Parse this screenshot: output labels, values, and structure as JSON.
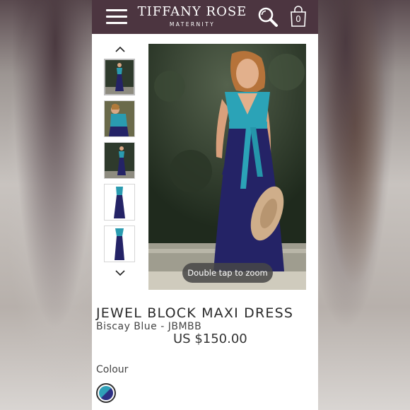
{
  "header": {
    "brand_name": "TIFFANY ROSE",
    "brand_sub": "MATERNITY",
    "bag_count": "0",
    "bg_color": "#4c3540"
  },
  "gallery": {
    "zoom_hint": "Double tap to zoom",
    "thumbnails": [
      "thumb-1",
      "thumb-2",
      "thumb-3",
      "thumb-4",
      "thumb-5"
    ],
    "active_index": 0
  },
  "product": {
    "name": "JEWEL BLOCK MAXI DRESS",
    "variant": "Biscay Blue - JBMBB",
    "price": "US $150.00",
    "colour_label": "Colour",
    "swatch_colors": [
      "#2fa0b8",
      "#2c2f84"
    ]
  }
}
